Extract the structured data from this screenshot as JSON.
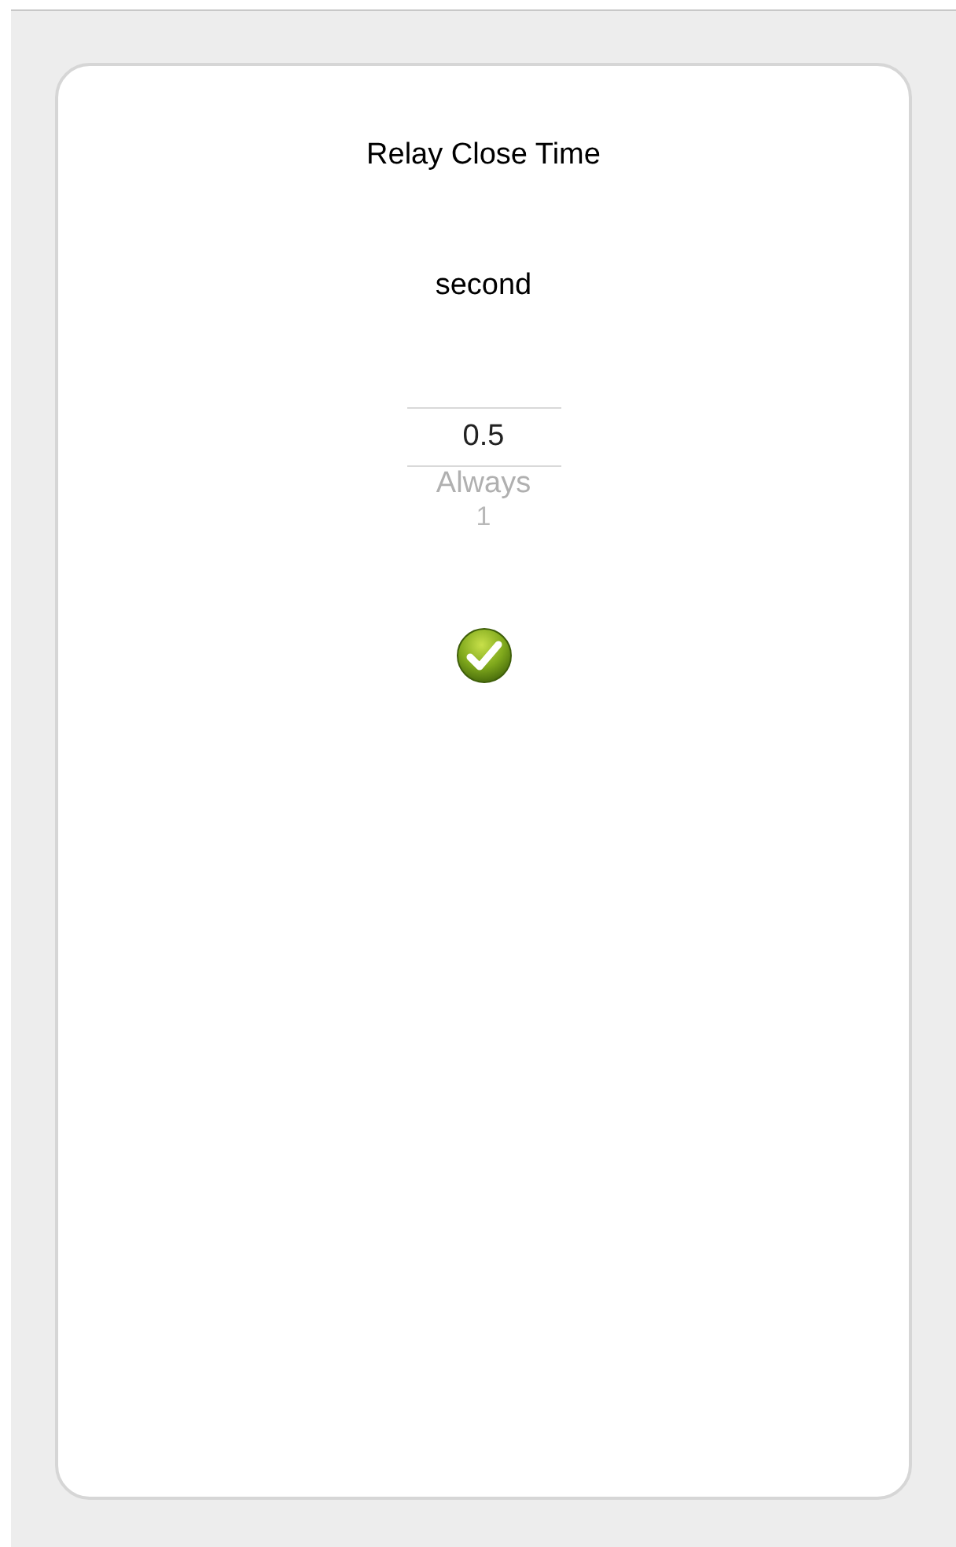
{
  "dialog": {
    "title": "Relay Close Time",
    "unit": "second"
  },
  "picker": {
    "items": [
      {
        "label": "0.5",
        "selected": true
      },
      {
        "label": "Always",
        "selected": false
      },
      {
        "label": "1",
        "selected": false
      }
    ]
  },
  "confirm_button": {
    "kind": "check"
  }
}
